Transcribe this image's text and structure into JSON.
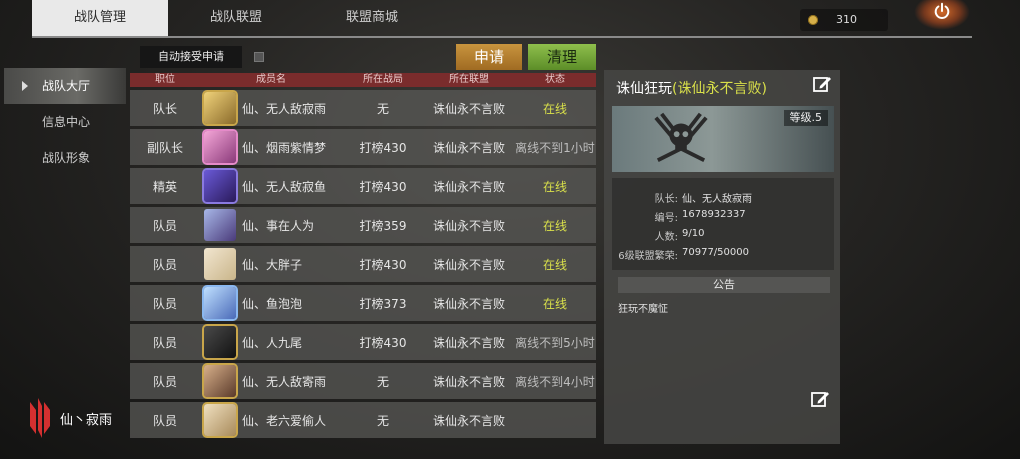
{
  "tabs": [
    "战队管理",
    "战队联盟",
    "联盟商城"
  ],
  "currency": "310",
  "sidebar": [
    "战队大厅",
    "信息中心",
    "战队形象"
  ],
  "controls": {
    "auto_accept": "自动接受申请",
    "apply": "申请",
    "clean": "清理"
  },
  "table": {
    "headers": [
      "职位",
      "成员名",
      "所在战局",
      "所在联盟",
      "状态"
    ],
    "rows": [
      {
        "role": "队长",
        "name": "仙、无人敌寂雨",
        "match": "无",
        "alliance": "诛仙永不言败",
        "status": "在线",
        "online": true
      },
      {
        "role": "副队长",
        "name": "仙、烟雨紫情梦",
        "match": "打榜430",
        "alliance": "诛仙永不言败",
        "status": "离线不到1小时",
        "online": false
      },
      {
        "role": "精英",
        "name": "仙、无人敌寂鱼",
        "match": "打榜430",
        "alliance": "诛仙永不言败",
        "status": "在线",
        "online": true
      },
      {
        "role": "队员",
        "name": "仙、事在人为",
        "match": "打榜359",
        "alliance": "诛仙永不言败",
        "status": "在线",
        "online": true
      },
      {
        "role": "队员",
        "name": "仙、大胖子",
        "match": "打榜430",
        "alliance": "诛仙永不言败",
        "status": "在线",
        "online": true
      },
      {
        "role": "队员",
        "name": "仙、鱼泡泡",
        "match": "打榜373",
        "alliance": "诛仙永不言败",
        "status": "在线",
        "online": true
      },
      {
        "role": "队员",
        "name": "仙、人九尾",
        "match": "打榜430",
        "alliance": "诛仙永不言败",
        "status": "离线不到5小时",
        "online": false
      },
      {
        "role": "队员",
        "name": "仙、无人敌寄雨",
        "match": "无",
        "alliance": "诛仙永不言败",
        "status": "离线不到4小时",
        "online": false
      },
      {
        "role": "队员",
        "name": "仙、老六爱偷人",
        "match": "无",
        "alliance": "诛仙永不言败",
        "status": "",
        "online": false
      }
    ]
  },
  "team": {
    "name": "诛仙狂玩",
    "alliance": "(诛仙永不言败)",
    "level": "等级.5",
    "captain_label": "队长:",
    "captain": "仙、无人敌寂雨",
    "id_label": "编号:",
    "id": "1678932337",
    "members_label": "人数:",
    "members": "9/10",
    "prosperity_label": "6级联盟繁荣:",
    "prosperity": "70977/50000",
    "notice_title": "公告",
    "notice": "狂玩不魔怔"
  },
  "watermark": "仙丶寂雨"
}
